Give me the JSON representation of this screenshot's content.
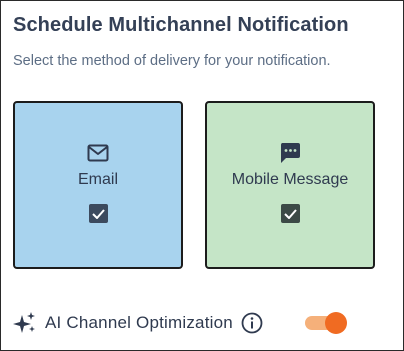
{
  "header": {
    "title": "Schedule Multichannel Notification",
    "subtitle": "Select the method of delivery for your notification."
  },
  "channels": [
    {
      "label": "Email",
      "icon": "envelope-icon",
      "checked": true,
      "color": "#a8d3ee"
    },
    {
      "label": "Mobile Message",
      "icon": "chat-bubble-icon",
      "checked": true,
      "color": "#c5e5c7"
    }
  ],
  "optimization": {
    "label": "AI Channel Optimization",
    "icon": "sparkle-icon",
    "info_icon": "info-icon",
    "enabled": true,
    "toggle_color": "#f06b22"
  }
}
